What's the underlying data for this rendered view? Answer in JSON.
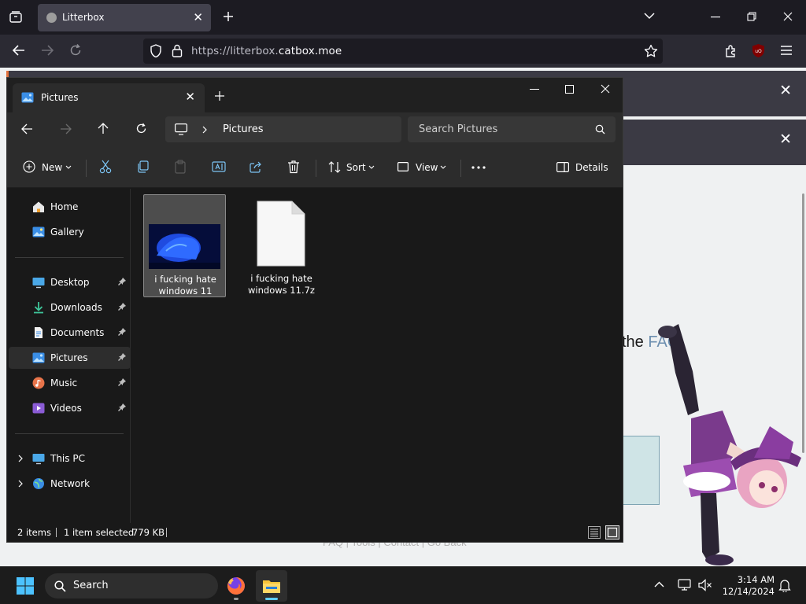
{
  "browser": {
    "tab_title": "Litterbox",
    "url_prefix": "https://litterbox.",
    "url_host": "catbox.moe"
  },
  "webpage": {
    "faq_prefix": "the",
    "faq_link": "FAQ",
    "footer_links": "FAQ | Tools | Contact | Go Back"
  },
  "explorer": {
    "tab_title": "Pictures",
    "breadcrumb": "Pictures",
    "search_placeholder": "Search Pictures",
    "commands": {
      "new": "New",
      "sort": "Sort",
      "view": "View",
      "details": "Details"
    },
    "nav": {
      "home": "Home",
      "gallery": "Gallery",
      "desktop": "Desktop",
      "downloads": "Downloads",
      "documents": "Documents",
      "pictures": "Pictures",
      "music": "Music",
      "videos": "Videos",
      "this_pc": "This PC",
      "network": "Network"
    },
    "files": [
      {
        "name": "i fucking hate windows 11",
        "selected": true
      },
      {
        "name": "i fucking hate windows 11.7z",
        "selected": false
      }
    ],
    "status": {
      "items": "2 items",
      "selected": "1 item selected",
      "size": "779 KB"
    }
  },
  "taskbar": {
    "search_label": "Search",
    "time": "3:14 AM",
    "date": "12/14/2024"
  },
  "colors": {
    "accent": "#60cdff",
    "explorer_bg": "#191919",
    "browser_bg": "#1c1b22"
  }
}
